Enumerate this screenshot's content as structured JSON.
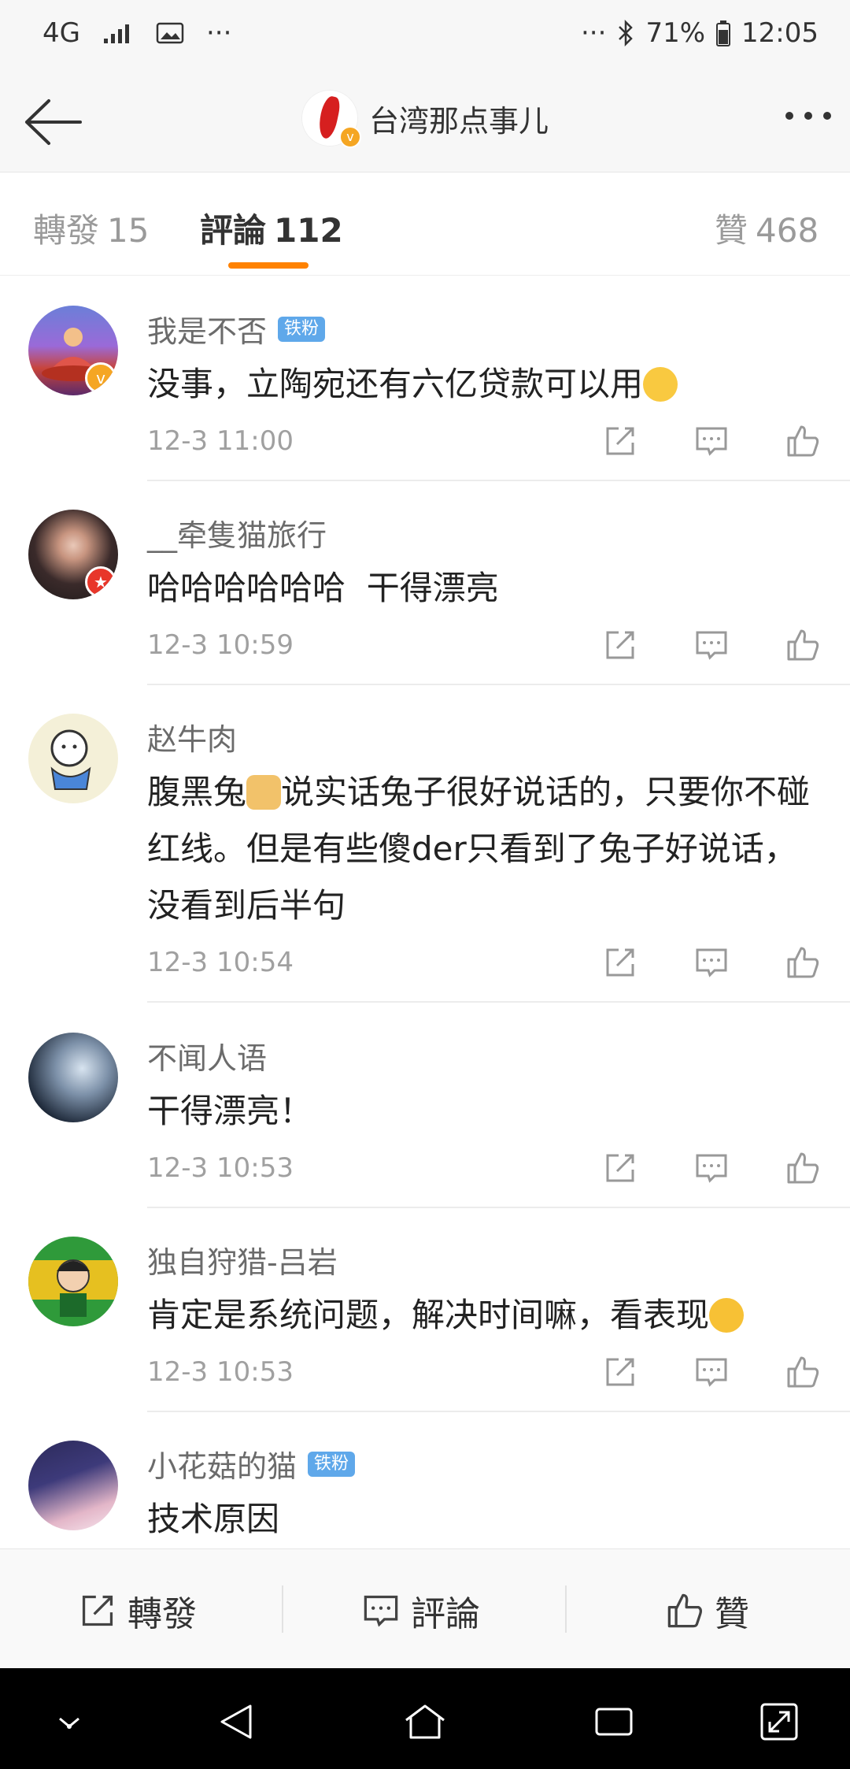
{
  "status_bar": {
    "network": "4G",
    "dots_left": "···",
    "dots_right": "···",
    "battery": "71%",
    "time": "12:05"
  },
  "header": {
    "title": "台湾那点事儿",
    "logo_badge": "v"
  },
  "tabs": {
    "repost_label": "轉發",
    "repost_count": "15",
    "comment_label": "評論",
    "comment_count": "112",
    "like_label": "贊",
    "like_count": "468"
  },
  "comments": [
    {
      "user": "我是不否",
      "badge": "铁粉",
      "text": "没事，立陶宛还有六亿贷款可以用",
      "time": "12-3 11:00",
      "avatar_badge": "v"
    },
    {
      "user": "__牵隻猫旅行",
      "badge": "",
      "text": "哈哈哈哈哈哈  干得漂亮",
      "time": "12-3 10:59",
      "avatar_badge": "★"
    },
    {
      "user": "赵牛肉",
      "badge": "",
      "text_parts": [
        "腹黑兔",
        "说实话兔子很好说话的，只要你不碰红线。但是有些傻der只看到了兔子好说话，没看到后半句"
      ],
      "time": "12-3 10:54"
    },
    {
      "user": "不闻人语",
      "badge": "",
      "text": "干得漂亮！",
      "time": "12-3 10:53"
    },
    {
      "user": "独自狩猎-吕岩",
      "badge": "",
      "text": "肯定是系统问题，解决时间嘛，看表现",
      "time": "12-3 10:53"
    },
    {
      "user": "小花菇的猫",
      "badge": "铁粉",
      "text": "技术原因",
      "time": ""
    }
  ],
  "bottom_bar": {
    "repost": "轉發",
    "comment": "評論",
    "like": "贊"
  },
  "colors": {
    "accent": "#ff8200",
    "fan_badge": "#5fa8ea",
    "verified": "#f5a623"
  },
  "icons": [
    "back-arrow-icon",
    "more-icon",
    "share-icon",
    "comment-icon",
    "like-icon",
    "nav-down-icon",
    "nav-back-icon",
    "nav-home-icon",
    "nav-recent-icon",
    "nav-expand-icon"
  ]
}
